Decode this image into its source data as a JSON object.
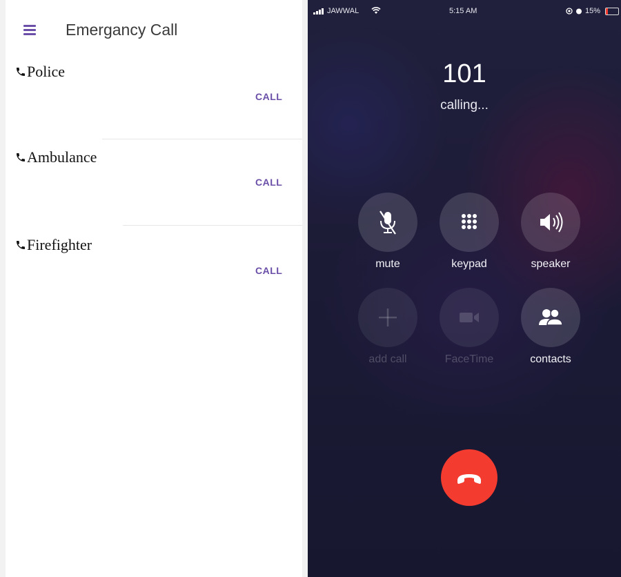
{
  "app": {
    "title": "Emergancy Call",
    "menu_icon": "hamburger-menu-icon",
    "accent_color": "#6a4ea8"
  },
  "contacts": [
    {
      "name": "Police",
      "action_label": "CALL",
      "icon": "phone-icon"
    },
    {
      "name": "Ambulance",
      "action_label": "CALL",
      "icon": "phone-icon"
    },
    {
      "name": "Firefighter",
      "action_label": "CALL",
      "icon": "phone-icon"
    }
  ],
  "phone": {
    "status_bar": {
      "carrier": "JAWWAL",
      "time": "5:15 AM",
      "battery": "15%"
    },
    "call": {
      "number": "101",
      "status": "calling..."
    },
    "controls": [
      {
        "label": "mute",
        "icon": "mute-microphone-icon",
        "enabled": true
      },
      {
        "label": "keypad",
        "icon": "keypad-icon",
        "enabled": true
      },
      {
        "label": "speaker",
        "icon": "speaker-icon",
        "enabled": true
      },
      {
        "label": "add call",
        "icon": "plus-icon",
        "enabled": false
      },
      {
        "label": "FaceTime",
        "icon": "video-camera-icon",
        "enabled": false
      },
      {
        "label": "contacts",
        "icon": "contacts-icon",
        "enabled": true
      }
    ],
    "end_call_icon": "hang-up-icon",
    "end_call_color": "#f33b30"
  }
}
